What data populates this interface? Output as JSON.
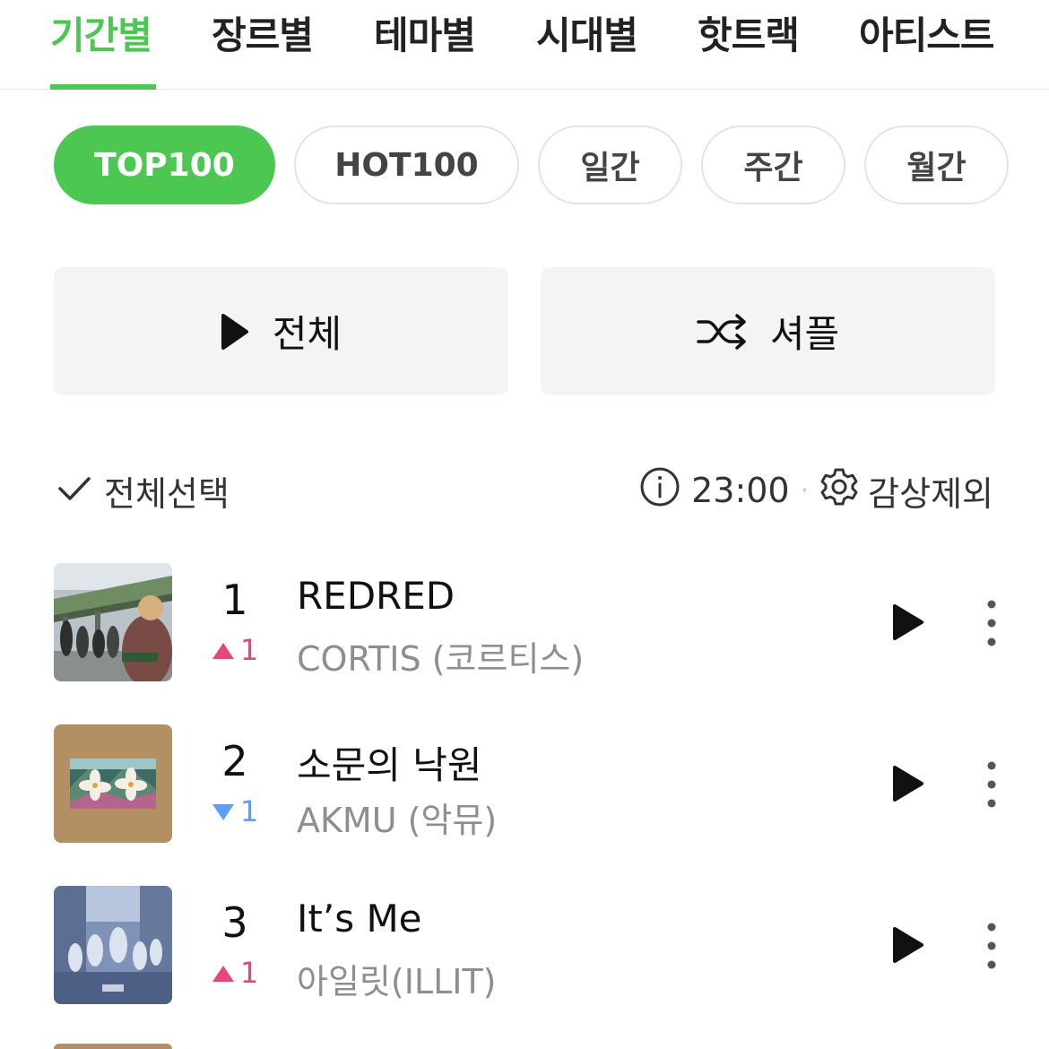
{
  "top_tabs": [
    {
      "label": "기간별",
      "active": true
    },
    {
      "label": "장르별",
      "active": false
    },
    {
      "label": "테마별",
      "active": false
    },
    {
      "label": "시대별",
      "active": false
    },
    {
      "label": "핫트랙",
      "active": false
    },
    {
      "label": "아티스트",
      "active": false
    }
  ],
  "chips": [
    {
      "label": "TOP100",
      "active": true
    },
    {
      "label": "HOT100",
      "active": false
    },
    {
      "label": "일간",
      "active": false
    },
    {
      "label": "주간",
      "active": false
    },
    {
      "label": "월간",
      "active": false
    }
  ],
  "actions": {
    "play_all_label": "전체",
    "shuffle_label": "셔플"
  },
  "toolbar": {
    "select_all_label": "전체선택",
    "update_time": "23:00",
    "exclude_label": "감상제외"
  },
  "songs": [
    {
      "rank": "1",
      "change_dir": "up",
      "change_amount": "1",
      "title": "REDRED",
      "artist": "CORTIS (코르티스)"
    },
    {
      "rank": "2",
      "change_dir": "down",
      "change_amount": "1",
      "title": "소문의 낙원",
      "artist": "AKMU (악뮤)"
    },
    {
      "rank": "3",
      "change_dir": "up",
      "change_amount": "1",
      "title": "It’s Me",
      "artist": "아일릿(ILLIT)"
    }
  ],
  "colors": {
    "accent": "#4cc752",
    "rank_up": "#e8457a",
    "rank_down": "#5b9ff7"
  },
  "icons": [
    "play-icon",
    "shuffle-icon",
    "check-icon",
    "info-icon",
    "gear-icon",
    "more-vertical-icon",
    "triangle-up-icon",
    "triangle-down-icon"
  ]
}
